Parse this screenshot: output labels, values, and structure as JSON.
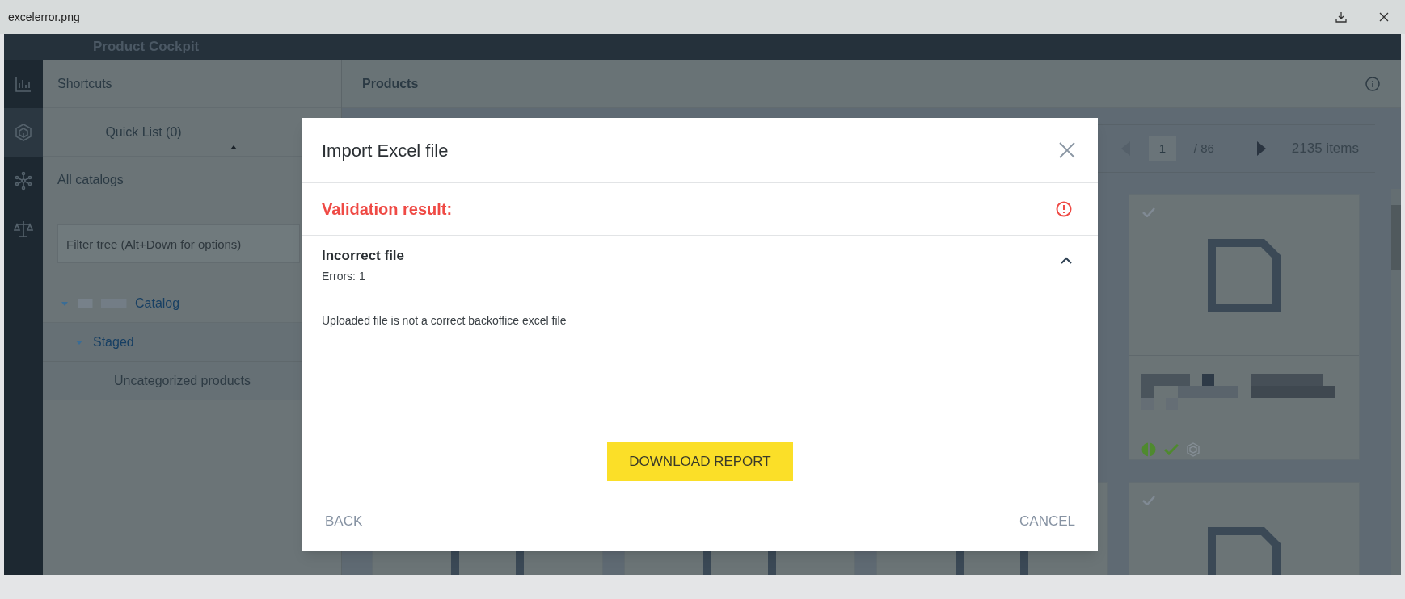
{
  "viewer": {
    "filename": "excelerror.png"
  },
  "app": {
    "title": "Product Cockpit"
  },
  "rail": [
    {
      "kind": "analytics",
      "selected": false
    },
    {
      "kind": "cube",
      "selected": true
    },
    {
      "kind": "network",
      "selected": false
    },
    {
      "kind": "scales",
      "selected": false
    }
  ],
  "sidebar": {
    "header": "Shortcuts",
    "quick_list": "Quick List (0)",
    "section": "All catalogs",
    "filter": {
      "placeholder": "Filter tree (Alt+Down for options)"
    },
    "tree": [
      {
        "label": "Catalog",
        "expanded": true,
        "children": [
          {
            "label": "Staged",
            "expanded": true,
            "children": [
              {
                "label": "Uncategorized products"
              }
            ]
          }
        ]
      }
    ]
  },
  "products": {
    "title": "Products",
    "pagination": {
      "page": "1",
      "total": "/ 86",
      "count": "2135 items"
    }
  },
  "modal": {
    "title": "Import Excel file",
    "validation": "Validation result:",
    "section": {
      "title": "Incorrect file",
      "subtitle": "Errors: 1",
      "expanded": true,
      "message": "Uploaded file is not a correct backoffice excel file"
    },
    "primary": "DOWNLOAD REPORT",
    "back": "BACK",
    "cancel": "CANCEL"
  }
}
